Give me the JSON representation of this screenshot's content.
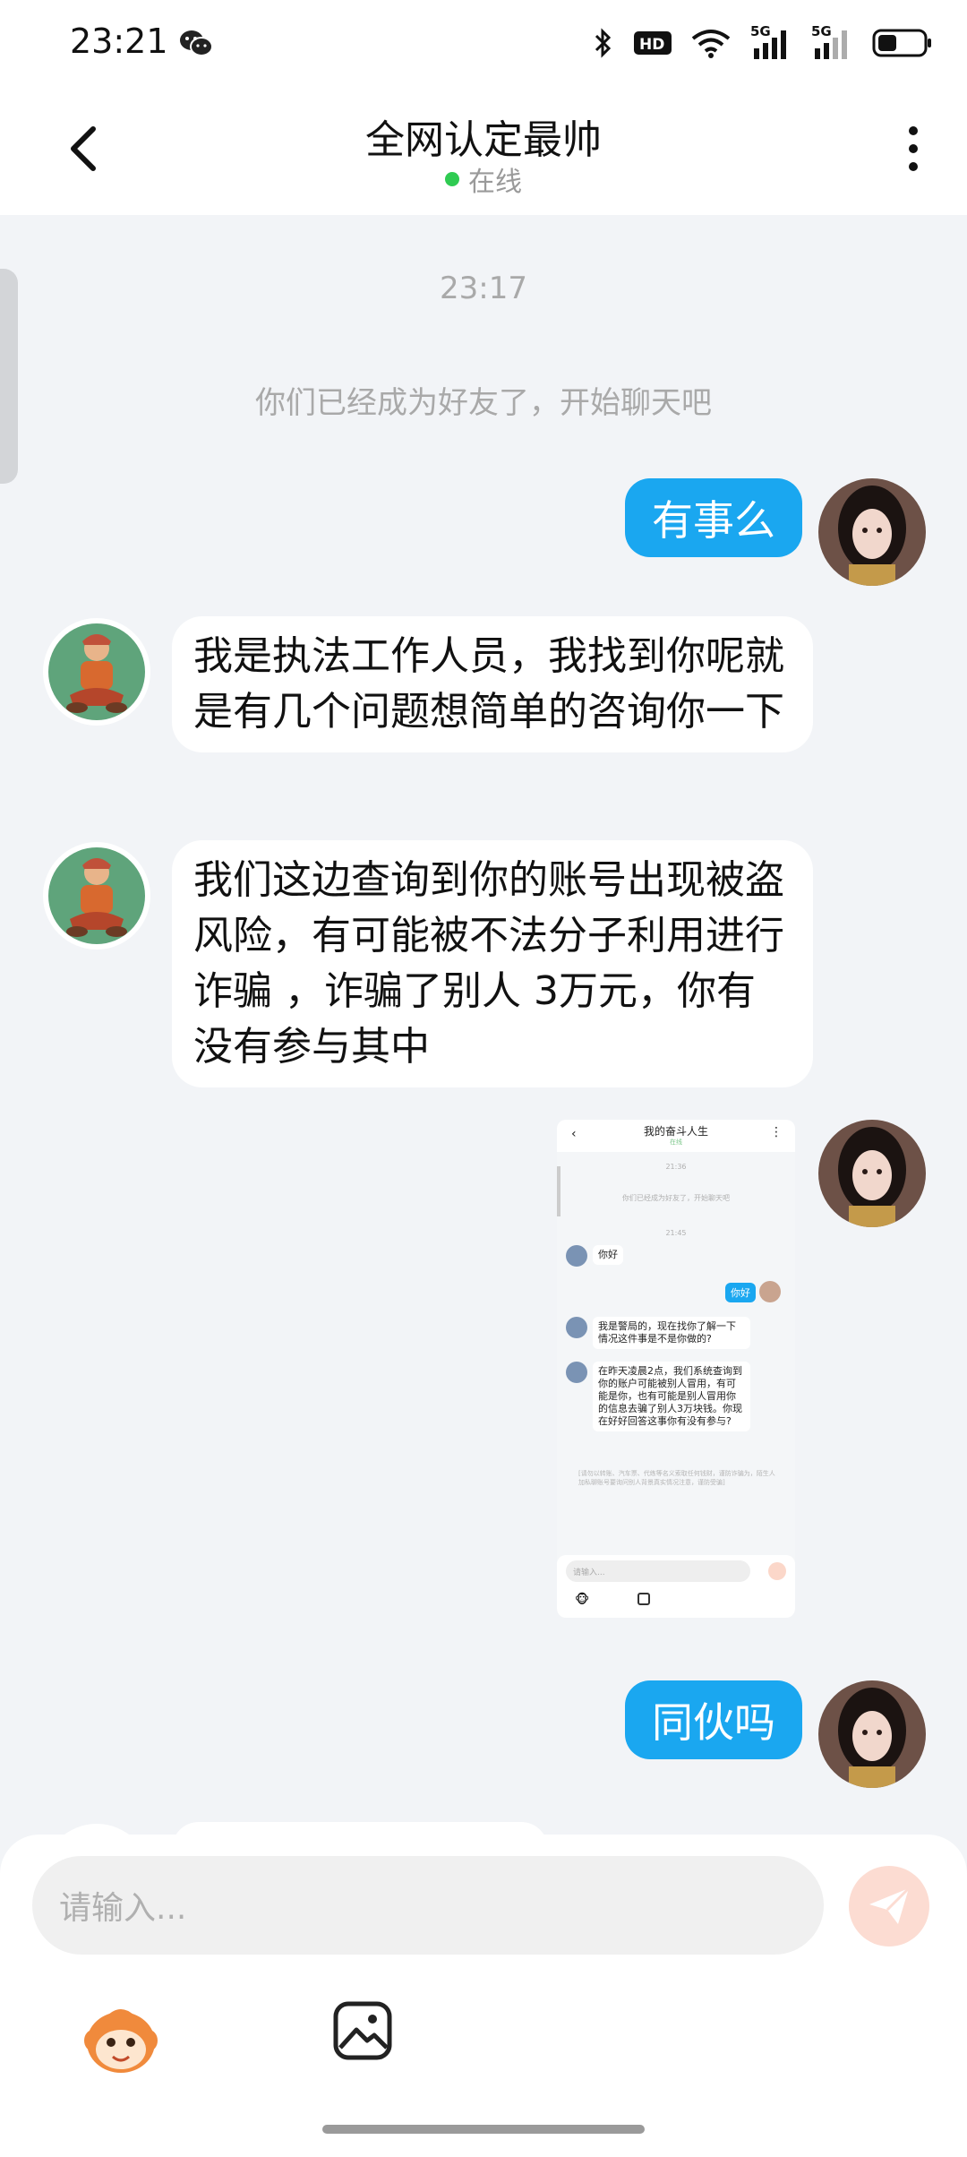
{
  "status_bar": {
    "time": "23:21",
    "network_1": "5G",
    "network_2": "5G",
    "hd_label": "HD2"
  },
  "header": {
    "title": "全网认定最帅",
    "status": "在线",
    "status_color": "#2fcb52"
  },
  "chat": {
    "timestamp": "23:17",
    "system_notice": "你们已经成为好友了，开始聊天吧",
    "messages": [
      {
        "side": "out",
        "text": "有事么"
      },
      {
        "side": "in",
        "text": "我是执法工作人员，我找到你呢就是有几个问题想简单的咨询你一下"
      },
      {
        "side": "in",
        "text": "我们这边查询到你的账号出现被盗风险，有可能被不法分子利用进行诈骗 ，诈骗了别人 3万元，你有没有参与其中"
      },
      {
        "side": "out",
        "type": "image"
      },
      {
        "side": "out",
        "text": "同伙吗"
      }
    ]
  },
  "screenshot_msg": {
    "title": "我的奋斗人生",
    "online": "在线",
    "time_1": "21:36",
    "notice": "你们已经成为好友了，开始聊天吧",
    "time_2": "21:45",
    "msg_1": "你好",
    "msg_2": "你好",
    "msg_3": "我是警局的，现在找你了解一下情况这件事是不是你做的?",
    "msg_4": "在昨天凌晨2点，我们系统查询到你的账户可能被别人冒用，有可能是你，也有可能是别人冒用你的信息去骗了别人3万块钱。你现在好好回答这事你有没有参与?",
    "warning": "[请勿以转账、汽车票、代练等名义索取任何钱财，谨防诈骗为，陌生人加私聊账号要询问别人背景真实情况注意，谨防受骗]",
    "input_placeholder": "请输入..."
  },
  "input": {
    "placeholder": "请输入..."
  },
  "icons": {
    "back": "chevron-left-icon",
    "more": "more-vertical-icon",
    "send": "send-icon",
    "emoji": "monkey-emoji-icon",
    "image": "image-icon"
  },
  "colors": {
    "outgoing_bubble": "#1aa7f0",
    "send_button": "#fcdcd2"
  }
}
